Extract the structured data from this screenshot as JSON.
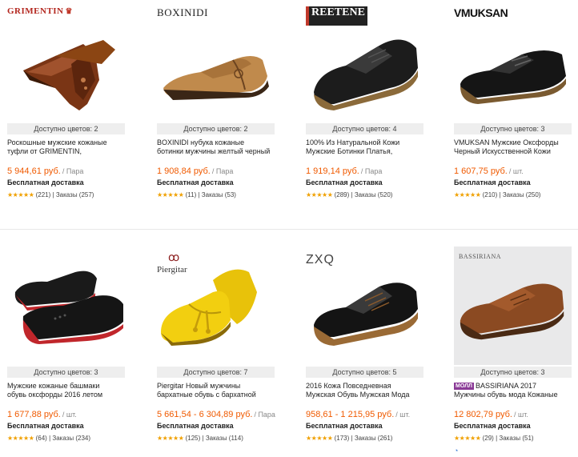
{
  "colors": {
    "price": "#f05a00",
    "stars": "#f0a000",
    "swatch_bar": "#eeeeee",
    "mall_badge": "#8a3a96"
  },
  "products": [
    {
      "brand": "GRIMENTIN",
      "colors_text": "Доступно цветов: 2",
      "title_l1": "Роскошные мужские кожаные",
      "title_l2": "туфли от GRIMENTIN,",
      "price": "5 944,61 руб.",
      "unit": "/ Пара",
      "shipping": "Бесплатная доставка",
      "stars": "★★★★★",
      "reviews": "(221)",
      "sep": "|",
      "orders": "Заказы (257)",
      "image_icon": "shoe-oxford-brown"
    },
    {
      "brand": "BOXINIDI",
      "colors_text": "Доступно цветов: 2",
      "title_l1": "BOXINIDI нубука кожаные",
      "title_l2": "ботинки мужчины желтый черный",
      "price": "1 908,84 руб.",
      "unit": "/ Пара",
      "shipping": "Бесплатная доставка",
      "stars": "★★★★★",
      "reviews": "(11)",
      "sep": "|",
      "orders": "Заказы (53)",
      "image_icon": "shoe-moccasin-tan"
    },
    {
      "brand": "REETENE",
      "colors_text": "Доступно цветов: 4",
      "title_l1": "100% Из Натуральной Кожи",
      "title_l2": "Мужские Ботинки Платья,",
      "price": "1 919,14 руб.",
      "unit": "/ Пара",
      "shipping": "Бесплатная доставка",
      "stars": "★★★★★",
      "reviews": "(289)",
      "sep": "|",
      "orders": "Заказы (520)",
      "image_icon": "shoe-derby-black"
    },
    {
      "brand": "VMUKSAN",
      "colors_text": "Доступно цветов: 3",
      "title_l1": "VMUKSAN Мужские Оксфорды",
      "title_l2": "Черный Искусственной Кожи",
      "price": "1 607,75 руб.",
      "unit": "/ шт.",
      "shipping": "Бесплатная доставка",
      "stars": "★★★★★",
      "reviews": "(210)",
      "sep": "|",
      "orders": "Заказы (250)",
      "image_icon": "shoe-oxford-black"
    },
    {
      "brand": "",
      "colors_text": "Доступно цветов: 3",
      "title_l1": "Мужские кожаные башмаки",
      "title_l2": "обувь оксфорды 2016 летом",
      "price": "1 677,88 руб.",
      "unit": "/ шт.",
      "shipping": "Бесплатная доставка",
      "stars": "★★★★★",
      "reviews": "(64)",
      "sep": "|",
      "orders": "Заказы (234)",
      "image_icon": "shoe-brogue-black-red"
    },
    {
      "brand": "Piergitar",
      "colors_text": "Доступно цветов: 7",
      "title_l1": "Piergitar Новый мужчины",
      "title_l2": "бархатные обувь с бархатной",
      "price": "5 661,54 - 6 304,89 руб.",
      "unit": "/ Пара",
      "shipping": "Бесплатная доставка",
      "stars": "★★★★★",
      "reviews": "(125)",
      "sep": "|",
      "orders": "Заказы (114)",
      "image_icon": "shoe-loafer-yellow"
    },
    {
      "brand": "ZXQ",
      "colors_text": "Доступно цветов: 5",
      "title_l1": "2016 Кожа Повседневная",
      "title_l2": "Мужская Обувь Мужская Мода",
      "price": "958,61 - 1 215,95 руб.",
      "unit": "/ шт.",
      "shipping": "Бесплатная доставка",
      "stars": "★★★★★",
      "reviews": "(173)",
      "sep": "|",
      "orders": "Заказы (261)",
      "image_icon": "shoe-derby-black-brown-sole"
    },
    {
      "brand": "",
      "colors_text": "Доступно цветов: 3",
      "mall": "МОЛЛ",
      "title_l1": "BASSIRIANA 2017",
      "title_l2": "Мужчины обувь мода Кожаные",
      "price": "12 802,79 руб.",
      "unit": "/ шт.",
      "shipping": "Бесплатная доставка",
      "stars": "★★★★★",
      "reviews": "(29)",
      "sep": "|",
      "orders": "Заказы (51)",
      "image_icon": "shoe-derby-brown",
      "photo_label": "BASSIRIANA"
    }
  ]
}
